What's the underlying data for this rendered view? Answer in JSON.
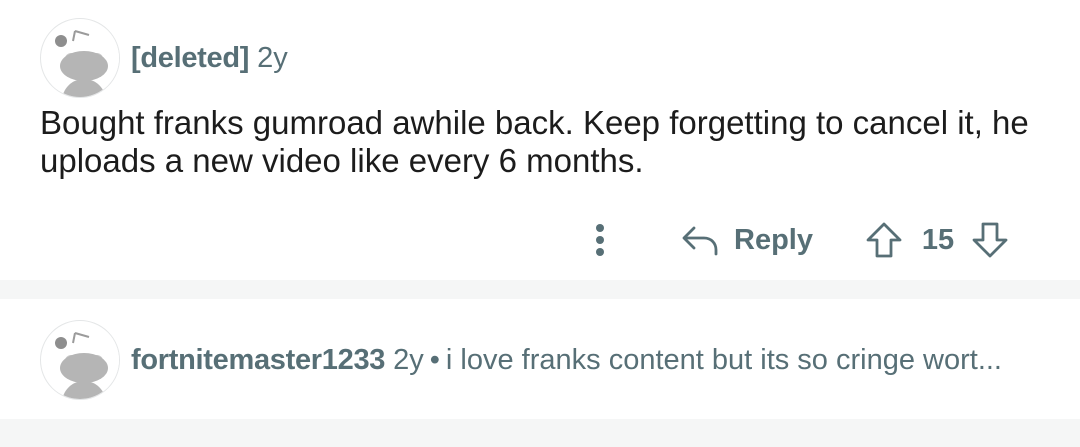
{
  "colors": {
    "text_primary": "#1c1c1c",
    "text_secondary": "#576f76",
    "separator": "#f5f6f6"
  },
  "comments": [
    {
      "author": "[deleted]",
      "age": "2y",
      "body": "Bought franks gumroad awhile back. Keep forgetting to cancel it, he uploads a new video like every 6 months.",
      "actions": {
        "more_icon": "kebab-vertical-icon",
        "reply_icon": "reply-arrow-icon",
        "reply_label": "Reply",
        "upvote_icon": "arrow-up-icon",
        "score": "15",
        "downvote_icon": "arrow-down-icon"
      }
    },
    {
      "author": "fortnitemaster1233",
      "age": "2y",
      "separator": "•",
      "preview": "i love franks content but its so cringe wort..."
    }
  ]
}
